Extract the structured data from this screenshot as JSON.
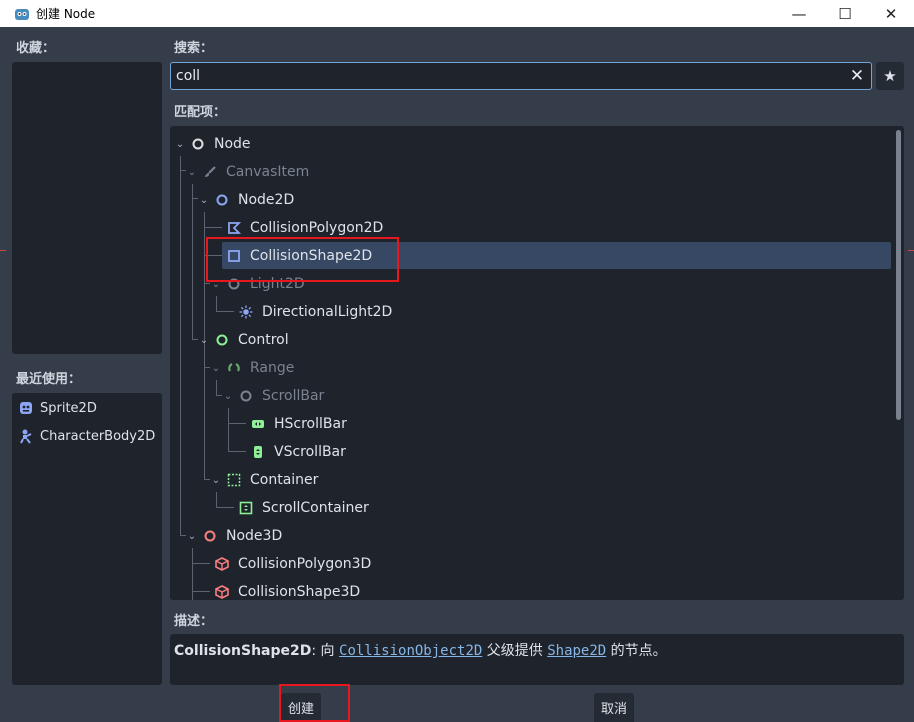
{
  "window": {
    "title": "创建 Node",
    "minimize": "—",
    "maximize": "☐",
    "close": "✕"
  },
  "favorites": {
    "label": "收藏："
  },
  "recent": {
    "label": "最近使用：",
    "items": [
      {
        "label": "Sprite2D",
        "icon": "sprite2d-icon"
      },
      {
        "label": "CharacterBody2D",
        "icon": "characterbody2d-icon"
      }
    ]
  },
  "search": {
    "label": "搜索：",
    "value": "coll",
    "clear_icon": "✕",
    "favorite_icon": "★"
  },
  "matches": {
    "label": "匹配项：",
    "rows": [
      {
        "label": "Node"
      },
      {
        "label": "CanvasItem"
      },
      {
        "label": "Node2D"
      },
      {
        "label": "CollisionPolygon2D"
      },
      {
        "label": "CollisionShape2D"
      },
      {
        "label": "Light2D"
      },
      {
        "label": "DirectionalLight2D"
      },
      {
        "label": "Control"
      },
      {
        "label": "Range"
      },
      {
        "label": "ScrollBar"
      },
      {
        "label": "HScrollBar"
      },
      {
        "label": "VScrollBar"
      },
      {
        "label": "Container"
      },
      {
        "label": "ScrollContainer"
      },
      {
        "label": "Node3D"
      },
      {
        "label": "CollisionPolygon3D"
      },
      {
        "label": "CollisionShape3D"
      }
    ]
  },
  "description": {
    "label": "描述：",
    "node": "CollisionShape2D",
    "text1": ": 向 ",
    "link1": "CollisionObject2D",
    "text2": " 父级提供 ",
    "link2": "Shape2D",
    "text3": " 的节点。"
  },
  "buttons": {
    "create": "创建",
    "cancel": "取消"
  },
  "colors": {
    "node2d_blue": "#8da5f3",
    "control_green": "#8eef97",
    "node3d_red": "#fc7f7f",
    "selection": "#364864",
    "accent": "#74a5d9",
    "highlight_box": "#e8171d"
  }
}
